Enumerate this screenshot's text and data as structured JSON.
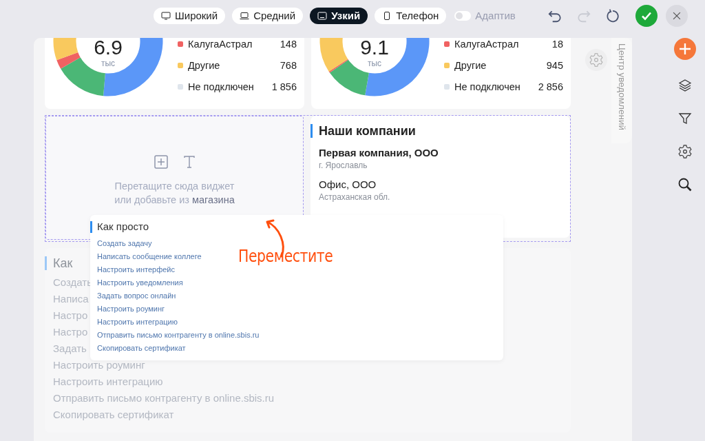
{
  "toolbar": {
    "layouts": [
      {
        "label": "Широкий",
        "kind": "monitor",
        "selected": false
      },
      {
        "label": "Средний",
        "kind": "laptop",
        "selected": false
      },
      {
        "label": "Узкий",
        "kind": "tablet",
        "selected": true
      },
      {
        "label": "Телефон",
        "kind": "phone",
        "selected": false
      }
    ],
    "adaptive": {
      "label": "Адаптив",
      "on": false
    },
    "actions": [
      {
        "kind": "undo",
        "disabled": false
      },
      {
        "kind": "redo",
        "disabled": true
      },
      {
        "kind": "reload",
        "disabled": false
      },
      {
        "kind": "apply",
        "disabled": false
      },
      {
        "kind": "close",
        "disabled": false
      }
    ]
  },
  "donut_cards": [
    {
      "total": "6.9",
      "unit": "тыс",
      "legend": [
        {
          "label": "КалугаАстрал",
          "value": "148",
          "color": "#f06262"
        },
        {
          "label": "Другие",
          "value": "768",
          "color": "#f9c95e"
        },
        {
          "label": "Не подключен",
          "value": "1 856",
          "color": "#dfe5ec"
        }
      ]
    },
    {
      "total": "9.1",
      "unit": "тыс",
      "legend": [
        {
          "label": "КалугаАстрал",
          "value": "18",
          "color": "#f06262"
        },
        {
          "label": "Другие",
          "value": "945",
          "color": "#f9c95e"
        },
        {
          "label": "Не подключен",
          "value": "2 856",
          "color": "#dfe5ec"
        }
      ]
    }
  ],
  "drop_zone": {
    "hint": "Перетащите сюда виджет или добавьте из",
    "link": "магазина"
  },
  "companies": {
    "title": "Наши компании",
    "items": [
      {
        "name": "Первая компания, ООО",
        "address": "г. Ярославль"
      },
      {
        "name": "Офис, ООО",
        "address": "Астраханская обл."
      }
    ]
  },
  "faded_widget": {
    "title": "Как",
    "links": [
      "Создать",
      "Написа",
      "Настро",
      "Настро",
      "Задать",
      "Настроить роуминг",
      "Настроить интеграцию",
      "Отправить письмо контрагенту в online.sbis.ru",
      "Скопировать сертификат"
    ]
  },
  "dragged_widget": {
    "title": "Как просто",
    "links": [
      "Создать задачу",
      "Написать сообщение коллеге",
      "Настроить интерфейс",
      "Настроить уведомления",
      "Задать вопрос онлайн",
      "Настроить роуминг",
      "Настроить интеграцию",
      "Отправить письмо контрагенту в online.sbis.ru",
      "Скопировать сертификат"
    ]
  },
  "annotation": {
    "text": "Переместите"
  },
  "notification_panel": {
    "title": "Центр уведомлений"
  },
  "right_rail": [
    {
      "kind": "add"
    },
    {
      "kind": "layers"
    },
    {
      "kind": "filter"
    },
    {
      "kind": "settings"
    },
    {
      "kind": "search"
    }
  ]
}
